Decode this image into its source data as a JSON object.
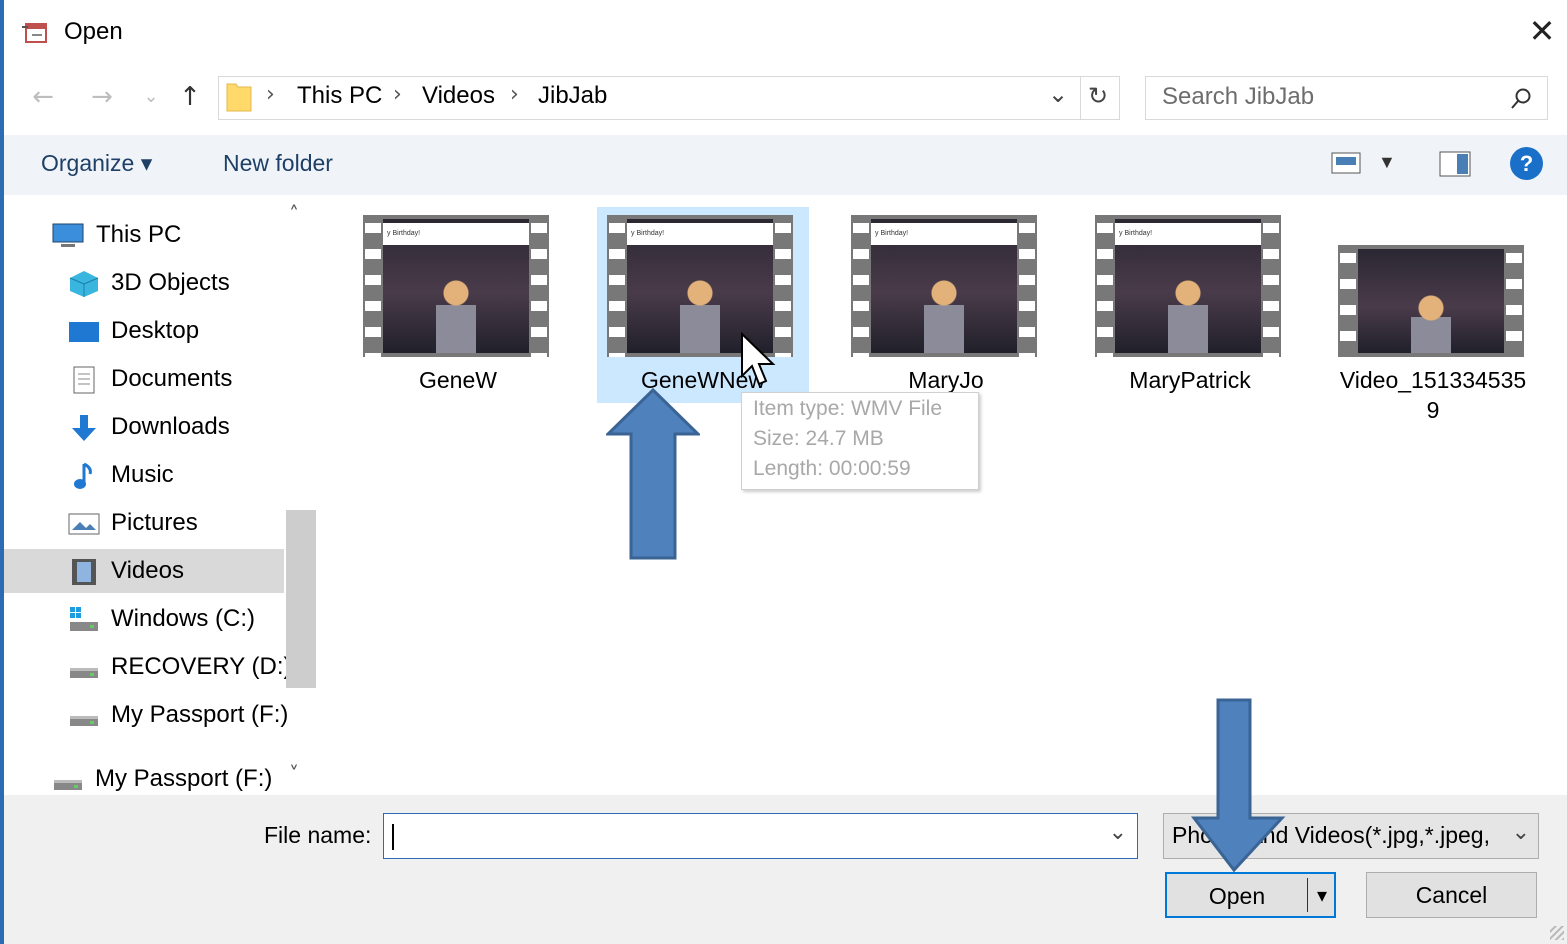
{
  "window": {
    "title": "Open",
    "close_glyph": "✕"
  },
  "nav": {
    "back": "←",
    "forward": "→",
    "recent": "⌄",
    "up": "↑"
  },
  "address": {
    "crumbs": [
      "This PC",
      "Videos",
      "JibJab"
    ],
    "separator": "›",
    "dropdown": "⌄",
    "refresh": "↻"
  },
  "search": {
    "placeholder": "Search JibJab"
  },
  "toolbar": {
    "organize": "Organize ▾",
    "new_folder": "New folder",
    "help": "?"
  },
  "sidebar": {
    "items": [
      {
        "label": "This PC",
        "icon": "monitor-icon"
      },
      {
        "label": "3D Objects",
        "icon": "cube-icon"
      },
      {
        "label": "Desktop",
        "icon": "desktop-icon"
      },
      {
        "label": "Documents",
        "icon": "document-icon"
      },
      {
        "label": "Downloads",
        "icon": "download-icon"
      },
      {
        "label": "Music",
        "icon": "music-icon"
      },
      {
        "label": "Pictures",
        "icon": "picture-icon"
      },
      {
        "label": "Videos",
        "icon": "video-icon",
        "selected": true
      },
      {
        "label": "Windows (C:)",
        "icon": "drive-icon"
      },
      {
        "label": "RECOVERY (D:)",
        "icon": "drive-icon"
      },
      {
        "label": "My Passport (F:)",
        "icon": "drive-icon"
      },
      {
        "label": "My Passport (F:)",
        "icon": "drive-icon"
      }
    ],
    "scroll_up": "˄",
    "scroll_down": "˅"
  },
  "files": [
    {
      "name": "GeneW",
      "banner": "y Birthday!"
    },
    {
      "name": "GeneWNew",
      "banner": "y Birthday!",
      "selected": true
    },
    {
      "name": "MaryJo",
      "banner": "y Birthday!"
    },
    {
      "name": "MaryPatrick",
      "banner": "y Birthday!"
    },
    {
      "name": "Video_151334535",
      "name_line2": "9",
      "banner": ""
    }
  ],
  "tooltip": {
    "type": "Item type: WMV File",
    "size": "Size: 24.7 MB",
    "length": "Length: 00:00:59"
  },
  "bottom": {
    "filename_label": "File name:",
    "filename_value": "",
    "filename_dropdown": "⌄",
    "filetype": "Photos and Videos(*.jpg,*.jpeg,",
    "filetype_dropdown": "⌄",
    "open_label": "Open",
    "open_split": "▾",
    "cancel_label": "Cancel"
  },
  "colors": {
    "accent": "#0078d7",
    "selection": "#cce8ff",
    "annotation_arrow": "#4f81bd"
  }
}
